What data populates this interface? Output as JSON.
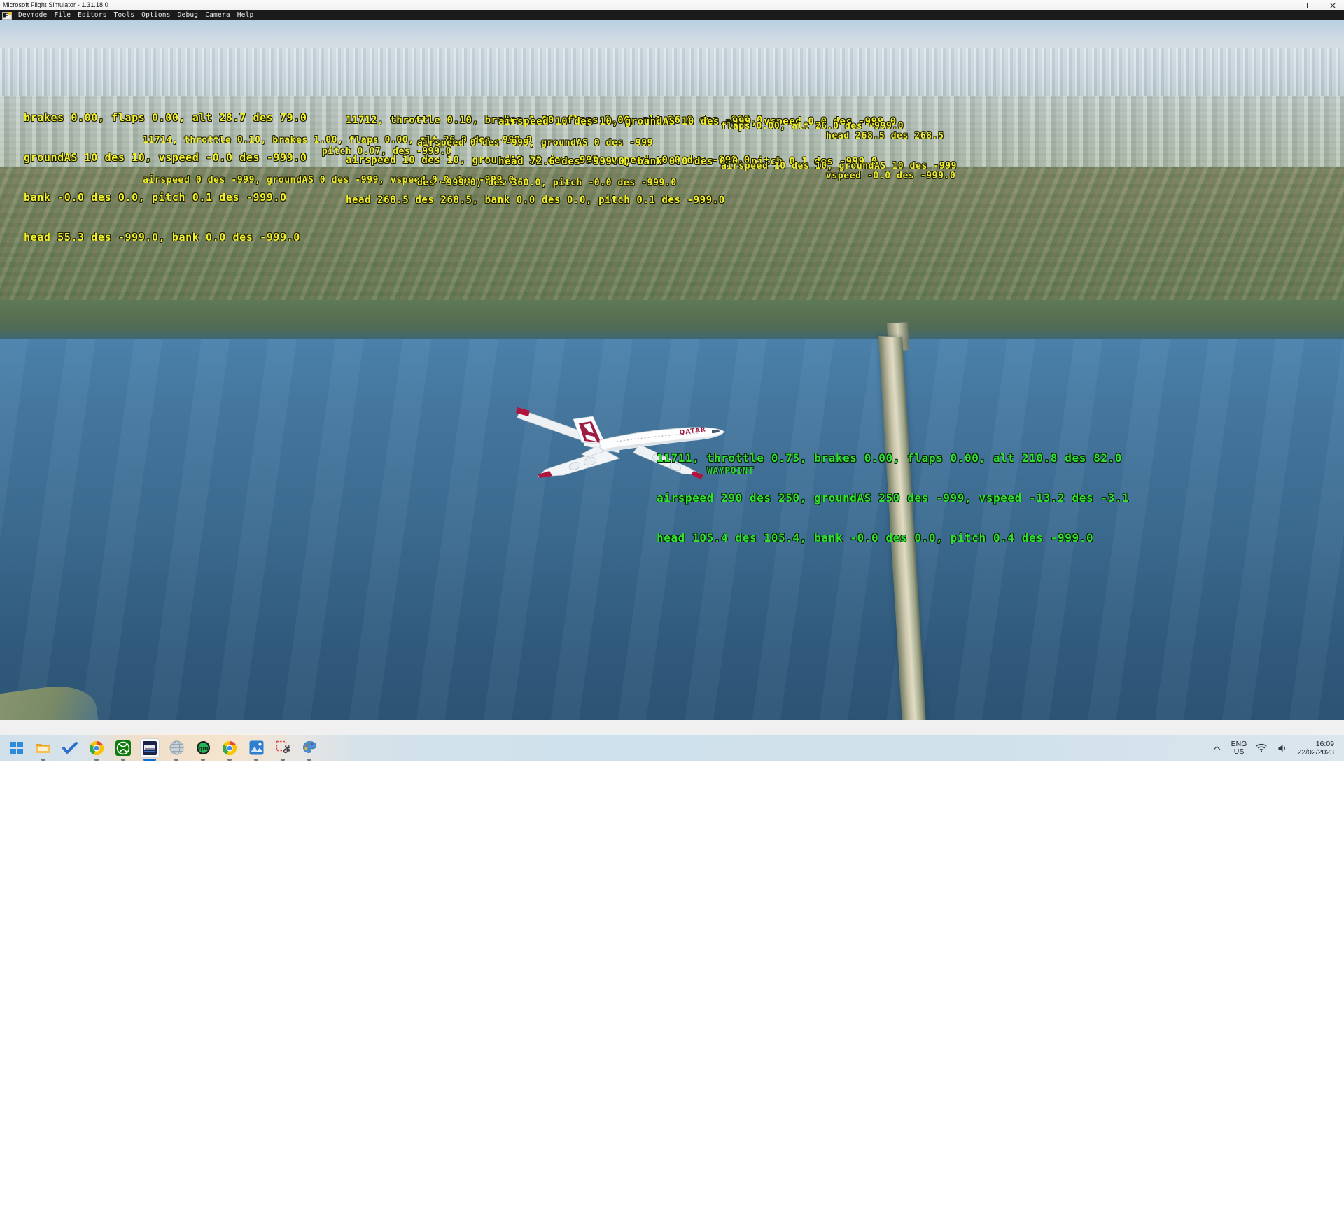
{
  "window": {
    "title": "Microsoft Flight Simulator - 1.31.18.0",
    "controls": {
      "minimize": "minimize",
      "maximize": "maximize",
      "close": "close"
    }
  },
  "menubar": {
    "logo_label": "Devmode logo",
    "items": [
      {
        "label": "Devmode"
      },
      {
        "label": "File"
      },
      {
        "label": "Editors"
      },
      {
        "label": "Tools"
      },
      {
        "label": "Options"
      },
      {
        "label": "Debug"
      },
      {
        "label": "Camera"
      },
      {
        "label": "Help"
      }
    ]
  },
  "viewport": {
    "scene": "aerial view of a Qatar Airways A380 flying over a large lake with a causeway, suburbs and an airport in the distance",
    "aircraft": {
      "livery": "QATAR",
      "type": "A380"
    }
  },
  "telemetry": {
    "main": {
      "color": "#32e032",
      "line1": "11711, throttle 0.75, brakes 0.00, flaps 0.00, alt 210.8 des 82.0",
      "line2": "airspeed 290 des 250, groundAS 250 des -999, vspeed -13.2 des -3.1",
      "line2_overlap": "WAYPOINT",
      "line3": "head 105.4 des 105.4, bank -0.0 des 0.0, pitch 0.4 des -999.0"
    },
    "traffic": {
      "color": "#f2f22a",
      "blocks": [
        {
          "id": "tele-a",
          "line1": "brakes 0.00, flaps 0.00, alt 28.7 des 79.0",
          "line2": "groundAS 10 des 10, vspeed -0.0 des -999.0",
          "line3": "bank -0.0 des 0.0, pitch 0.1 des -999.0",
          "line4": "head 55.3 des -999.0, bank 0.0 des -999.0"
        },
        {
          "id": "tele-b",
          "line1": "11712, throttle 0.10, brakes 1.00, flaps 0.00, alt 26.0 des -999.0",
          "line2": "airspeed 10 des 10, groundAS 10 des -999, vspeed -0.0 des -999.0",
          "line3": "head 268.5 des 268.5, bank 0.0 des 0.0, pitch 0.1 des -999.0"
        },
        {
          "id": "tele-c",
          "line1": "airspeed 10 des 10, groundAS 10 des -999, vspeed 0.0 des -999.0",
          "line2": "head 72.6 des -999.0, bank 0.0 des 0.0, pitch 0.1 des -999.0"
        },
        {
          "id": "tele-d",
          "line1": "11714, throttle 0.10, brakes 1.00, flaps 0.00, alt 26.9 des -999.0",
          "line2": "airspeed 0 des -999, groundAS 0 des -999, vspeed 0.0 des -999.0"
        },
        {
          "id": "tele-e",
          "line1": "flaps 0.00, alt 26.0 des -999.0",
          "line2": "airspeed 10 des 10, groundAS 10 des -999"
        },
        {
          "id": "tele-f",
          "line1": "airspeed 0 des -999, groundAS 0 des -999",
          "line2": "des -999.0) des 360.0, pitch -0.0 des -999.0"
        },
        {
          "id": "tele-g",
          "line1": "head 268.5 des 268.5",
          "line2": "vspeed -0.0 des -999.0"
        },
        {
          "id": "tele-h",
          "line1": "pitch 0.07, des -999.0"
        }
      ]
    }
  },
  "taskbar": {
    "icons": [
      {
        "name": "start-button",
        "label": "Start",
        "state": "idle"
      },
      {
        "name": "file-explorer-icon",
        "label": "File Explorer",
        "state": "running"
      },
      {
        "name": "todo-icon",
        "label": "Microsoft To Do",
        "state": "idle"
      },
      {
        "name": "chrome-icon",
        "label": "Google Chrome",
        "state": "running"
      },
      {
        "name": "xbox-icon",
        "label": "Xbox",
        "state": "running"
      },
      {
        "name": "flight-simulator-icon",
        "label": "Microsoft Flight Simulator",
        "state": "active"
      },
      {
        "name": "globe-icon",
        "label": "Internet",
        "state": "running"
      },
      {
        "name": "green-app-icon",
        "label": "App",
        "state": "running"
      },
      {
        "name": "chrome-2-icon",
        "label": "Google Chrome",
        "state": "running"
      },
      {
        "name": "photos-icon",
        "label": "Photos",
        "state": "running"
      },
      {
        "name": "snipping-tool-icon",
        "label": "Snipping Tool",
        "state": "running"
      },
      {
        "name": "paint-icon",
        "label": "Paint",
        "state": "running"
      }
    ],
    "tray": {
      "chevron": "show-hidden-icons",
      "language_top": "ENG",
      "language_bottom": "US",
      "wifi": "wifi-icon",
      "volume": "volume-icon",
      "time": "16:09",
      "date": "22/02/2023"
    }
  }
}
